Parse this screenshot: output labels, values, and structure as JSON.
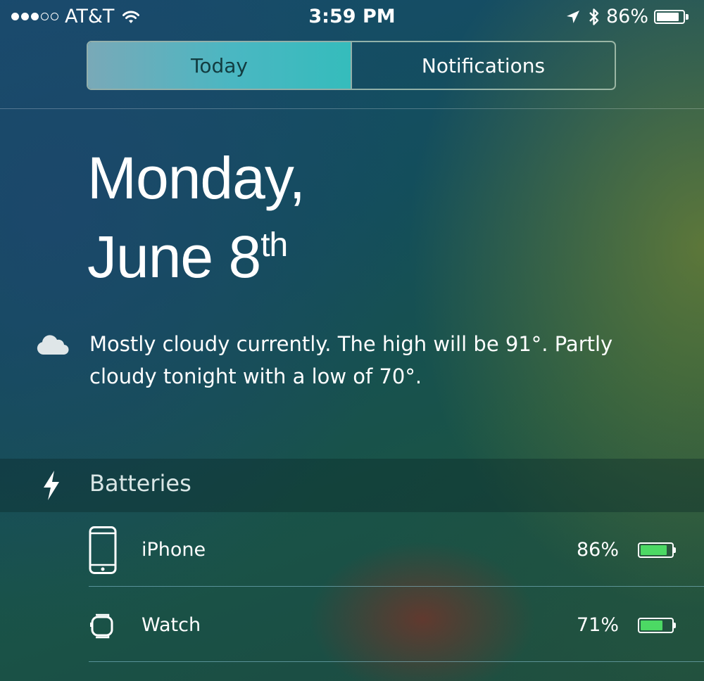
{
  "status_bar": {
    "signal_bars_filled": 3,
    "signal_bars_total": 5,
    "carrier": "AT&T",
    "time": "3:59 PM",
    "battery_percent": "86%",
    "battery_level": 0.86,
    "icons": [
      "wifi-icon",
      "location-arrow-icon",
      "bluetooth-icon",
      "battery-icon"
    ]
  },
  "segmented_control": {
    "tabs": [
      {
        "label": "Today",
        "selected": true
      },
      {
        "label": "Notifications",
        "selected": false
      }
    ]
  },
  "date": {
    "weekday_line": "Monday,",
    "date_line": "June 8",
    "date_suffix": "th"
  },
  "weather": {
    "icon": "cloud-icon",
    "summary": "Mostly cloudy currently. The high will be 91°. Partly cloudy tonight with a low of 70°."
  },
  "batteries": {
    "title": "Batteries",
    "icon": "lightning-bolt-icon",
    "devices": [
      {
        "name": "iPhone",
        "percent": "86%",
        "level": 0.86,
        "icon": "iphone-icon"
      },
      {
        "name": "Watch",
        "percent": "71%",
        "level": 0.71,
        "icon": "apple-watch-icon"
      }
    ]
  },
  "colors": {
    "battery_fill": "#4cd964",
    "segment_active": "#4ab7c2"
  }
}
